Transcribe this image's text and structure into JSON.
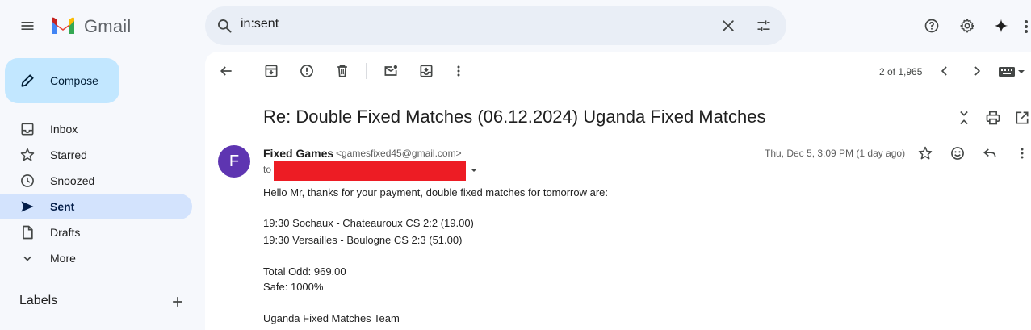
{
  "app": {
    "name": "Gmail"
  },
  "search": {
    "value": "in:sent"
  },
  "compose": {
    "label": "Compose"
  },
  "sidebar": {
    "items": [
      {
        "label": "Inbox",
        "icon": "inbox-icon"
      },
      {
        "label": "Starred",
        "icon": "star-icon"
      },
      {
        "label": "Snoozed",
        "icon": "clock-icon"
      },
      {
        "label": "Sent",
        "icon": "send-icon",
        "active": true
      },
      {
        "label": "Drafts",
        "icon": "draft-icon"
      },
      {
        "label": "More",
        "icon": "chevron-down-icon"
      }
    ],
    "labels_heading": "Labels"
  },
  "toolbar": {
    "pager": "2 of 1,965"
  },
  "email": {
    "subject": "Re: Double Fixed Matches (06.12.2024) Uganda Fixed Matches",
    "avatar_letter": "F",
    "sender_name": "Fixed Games",
    "sender_email": "<gamesfixed45@gmail.com>",
    "to_label": "to",
    "date": "Thu, Dec 5, 3:09 PM (1 day ago)",
    "body": {
      "greeting": "Hello Mr, thanks for your payment, double fixed matches for tomorrow are:",
      "match1": "19:30 Sochaux - Chateauroux CS 2:2 (19.00)",
      "match2": "19:30 Versailles - Boulogne CS 2:3 (51.00)",
      "total_odd": "Total Odd: 969.00",
      "safe": "Safe: 1000%",
      "signature": "Uganda Fixed Matches Team"
    }
  },
  "colors": {
    "accent": "#c2e7ff",
    "active_nav": "#d3e3fd",
    "avatar": "#5e35b1",
    "redaction": "#ed1c24"
  }
}
